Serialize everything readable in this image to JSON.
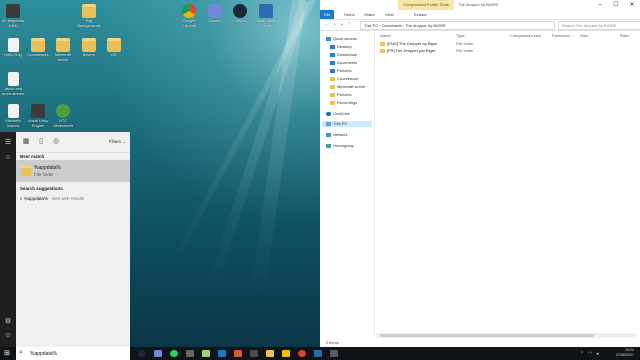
{
  "desktop_icons": [
    {
      "label": "AV Inspector (x64)",
      "kind": "shortcut"
    },
    {
      "label": "Big Backgrounds",
      "kind": "folder"
    },
    {
      "label": "Google Chrome",
      "kind": "chrome"
    },
    {
      "label": "Discord",
      "kind": "discord"
    },
    {
      "label": "Steam",
      "kind": "steam"
    },
    {
      "label": "Visual Studio Code",
      "kind": "vsc"
    },
    {
      "label": "Hello Dog",
      "kind": "file"
    },
    {
      "label": "Coursework",
      "kind": "folder"
    },
    {
      "label": "Minecraft server",
      "kind": "folder"
    },
    {
      "label": "drivers",
      "kind": "folder"
    },
    {
      "label": "BG",
      "kind": "folder"
    },
    {
      "label": "Jacob and more stories",
      "kind": "file"
    },
    {
      "label": "Macbeth Scenes",
      "kind": "file"
    },
    {
      "label": "Uncle Unity Engine",
      "kind": "shortcut"
    },
    {
      "label": "NTC Ultrasearch",
      "kind": "green"
    }
  ],
  "start_menu": {
    "filters_label": "Filters",
    "best_match_heading": "Best match",
    "best_match": {
      "title": "%appdata%",
      "subtitle": "File folder"
    },
    "search_suggestions_heading": "Search suggestions",
    "suggestion": {
      "text": "%appdata%",
      "suffix": " - See web results"
    },
    "search_value": "%appdata%"
  },
  "explorer": {
    "contextual_tab": "Compressed Folder Tools",
    "window_title": "The dropper by BIGRE",
    "ribbon_tabs": [
      "File",
      "Home",
      "Share",
      "View",
      "Extract"
    ],
    "breadcrumb": [
      "This PC",
      "Downloads",
      "The dropper by BIGRE"
    ],
    "search_placeholder": "Search The dropper by BIGRE",
    "nav_items": [
      {
        "label": "Quick access",
        "icon": "star"
      },
      {
        "label": "Desktop",
        "icon": "blue"
      },
      {
        "label": "Downloads",
        "icon": "blue"
      },
      {
        "label": "Documents",
        "icon": "blue"
      },
      {
        "label": "Pictures",
        "icon": "blue"
      },
      {
        "label": "Coursework",
        "icon": "fold"
      },
      {
        "label": "Minecraft server",
        "icon": "fold"
      },
      {
        "label": "Pictures",
        "icon": "fold"
      },
      {
        "label": "Recordings",
        "icon": "fold"
      },
      {
        "label": "OneDrive",
        "icon": "cloud"
      },
      {
        "label": "This PC",
        "icon": "pc"
      },
      {
        "label": "Network",
        "icon": "net"
      },
      {
        "label": "Homegroup",
        "icon": "home"
      }
    ],
    "columns": [
      "Name",
      "Type",
      "Compressed size",
      "Password ...",
      "Size",
      "Ratio"
    ],
    "files": [
      {
        "name": "[ENG] The Dropper by Bigre",
        "type": "File folder"
      },
      {
        "name": "[FR] The Dropper par Bigre",
        "type": "File folder"
      }
    ],
    "status": "2 items"
  },
  "taskbar": {
    "time": "15:24",
    "date": "27/06/2017"
  }
}
